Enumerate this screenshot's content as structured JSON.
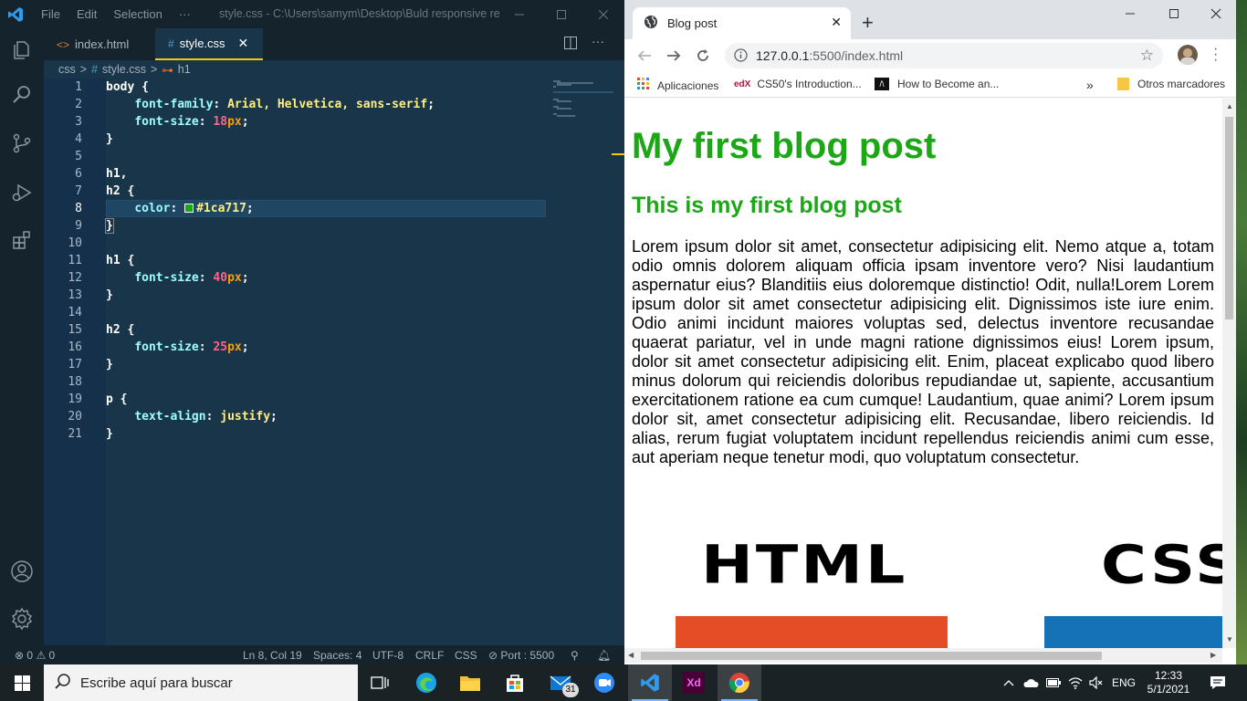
{
  "vscode": {
    "menu": [
      "File",
      "Edit",
      "Selection",
      "···"
    ],
    "title": "style.css - C:\\Users\\samym\\Desktop\\Buld responsive rea...",
    "tabs": [
      {
        "label": "index.html",
        "icon": "<>"
      },
      {
        "label": "style.css",
        "icon": "#"
      }
    ],
    "breadcrumb": [
      "css",
      ">",
      "#",
      "style.css",
      ">",
      "h1"
    ],
    "line_numbers": [
      "1",
      "2",
      "3",
      "4",
      "5",
      "6",
      "7",
      "8",
      "9",
      "10",
      "11",
      "12",
      "13",
      "14",
      "15",
      "16",
      "17",
      "18",
      "19",
      "20",
      "21"
    ],
    "code": {
      "l1_sel": "body",
      "l2_prop": "font-family",
      "l2_val": "Arial, Helvetica, sans-serif",
      "l3_prop": "font-size",
      "l3_num": "18",
      "l3_unit": "px",
      "l6_sel": "h1,",
      "l7_sel": "h2",
      "l8_prop": "color",
      "l8_val": "#1ca717",
      "l11_sel": "h1",
      "l12_prop": "font-size",
      "l12_num": "40",
      "l12_unit": "px",
      "l15_sel": "h2",
      "l16_prop": "font-size",
      "l16_num": "25",
      "l16_unit": "px",
      "l19_sel": "p",
      "l20_prop": "text-align",
      "l20_val": "justify"
    },
    "status": {
      "problems": "0",
      "warnings": "0",
      "position": "Ln 8, Col 19",
      "spaces": "Spaces: 4",
      "encoding": "UTF-8",
      "eol": "CRLF",
      "language": "CSS",
      "port": "Port : 5500"
    }
  },
  "chrome": {
    "tab_title": "Blog post",
    "url_host": "127.0.0.1",
    "url_rest": ":5500/index.html",
    "bookmarks": [
      "Aplicaciones",
      "CS50's Introduction...",
      "How to Become an...",
      "Otros marcadores"
    ],
    "page": {
      "h1": "My first blog post",
      "h2": "This is my first blog post",
      "paragraph": "Lorem ipsum dolor sit amet, consectetur adipisicing elit. Nemo atque a, totam odio omnis dolorem aliquam officia ipsam inventore vero? Nisi laudantium aspernatur eius? Blanditiis eius doloremque distinctio! Odit, nulla!Lorem Lorem ipsum dolor sit amet consectetur adipisicing elit. Dignissimos iste iure enim. Odio animi incidunt maiores voluptas sed, delectus inventore recusandae quaerat pariatur, vel in unde magni ratione dignissimos eius! Lorem ipsum, dolor sit amet consectetur adipisicing elit. Enim, placeat explicabo quod libero minus dolorum qui reiciendis doloribus repudiandae ut, sapiente, accusantium exercitationem ratione ea cum cumque! Laudantium, quae animi? Lorem ipsum dolor sit, amet consectetur adipisicing elit. Recusandae, libero reiciendis. Id alias, rerum fugiat voluptatem incidunt repellendus reiciendis animi cum esse, aut aperiam neque tenetur modi, quo voluptatum consectetur.",
      "logo1_text": "HTML",
      "logo2_text": "CSS"
    }
  },
  "taskbar": {
    "search_placeholder": "Escribe aquí para buscar",
    "mail_badge": "31",
    "lang": "ENG",
    "time": "12:33",
    "date": "5/1/2021"
  },
  "colors": {
    "heading_green": "#1ca717",
    "vscode_bg": "#193549",
    "vscode_dark": "#15232d",
    "accent": "#ffc600"
  }
}
